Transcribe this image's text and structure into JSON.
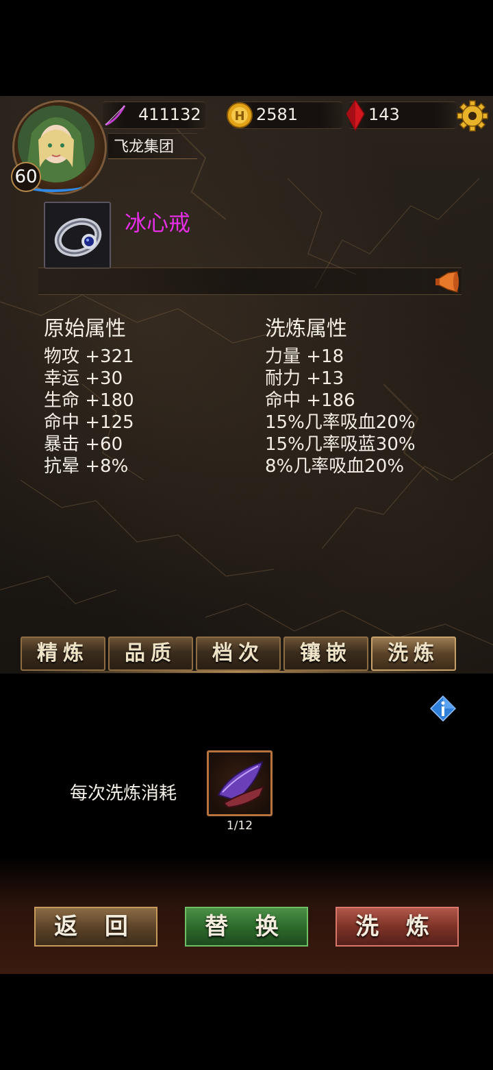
{
  "header": {
    "level": "60",
    "power": "411132",
    "gold": "2581",
    "gems": "143",
    "guild": "飞龙集团"
  },
  "item": {
    "name": "冰心戒",
    "name_color": "#e62ee6"
  },
  "attributes": {
    "original_title": "原始属性",
    "original": [
      "物攻 +321",
      "幸运 +30",
      "生命 +180",
      "命中 +125",
      "暴击 +60",
      "抗晕 +8%"
    ],
    "refined_title": "洗炼属性",
    "refined": [
      "力量 +18",
      "耐力 +13",
      "命中 +186",
      "15%几率吸血20%",
      "15%几率吸蓝30%",
      "8%几率吸血20%"
    ]
  },
  "tabs": [
    "精炼",
    "品质",
    "档次",
    "镶嵌",
    "洗炼"
  ],
  "active_tab": "洗炼",
  "cost": {
    "label": "每次洗炼消耗",
    "count": "1/12"
  },
  "buttons": {
    "back": "返 回",
    "replace": "替 换",
    "refine": "洗 炼"
  },
  "icons": {
    "settings": "gear-icon",
    "gold": "coin-icon",
    "gems": "red-crystal-icon",
    "power": "bow-icon",
    "info": "info-icon",
    "horn": "horn-icon",
    "ring": "ring-icon",
    "material": "purple-feather-icon"
  }
}
